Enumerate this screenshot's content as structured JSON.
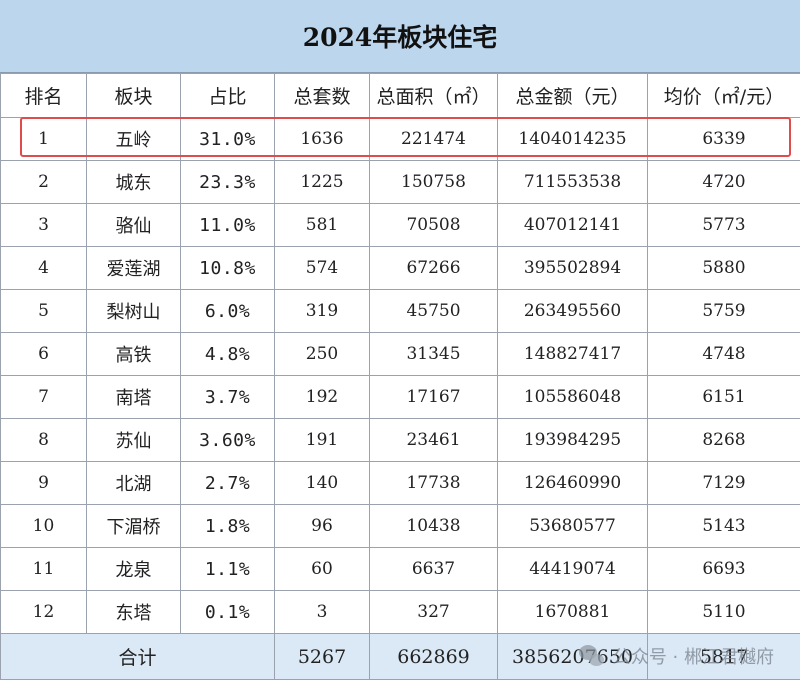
{
  "title": "2024年板块住宅",
  "headers": [
    "排名",
    "板块",
    "占比",
    "总套数",
    "总面积（㎡）",
    "总金额（元）",
    "均价（㎡/元）"
  ],
  "rows": [
    [
      "1",
      "五岭",
      "31.0%",
      "1636",
      "221474",
      "1404014235",
      "6339"
    ],
    [
      "2",
      "城东",
      "23.3%",
      "1225",
      "150758",
      "711553538",
      "4720"
    ],
    [
      "3",
      "骆仙",
      "11.0%",
      "581",
      "70508",
      "407012141",
      "5773"
    ],
    [
      "4",
      "爱莲湖",
      "10.8%",
      "574",
      "67266",
      "395502894",
      "5880"
    ],
    [
      "5",
      "梨树山",
      "6.0%",
      "319",
      "45750",
      "263495560",
      "5759"
    ],
    [
      "6",
      "高铁",
      "4.8%",
      "250",
      "31345",
      "148827417",
      "4748"
    ],
    [
      "7",
      "南塔",
      "3.7%",
      "192",
      "17167",
      "105586048",
      "6151"
    ],
    [
      "8",
      "苏仙",
      "3.60%",
      "191",
      "23461",
      "193984295",
      "8268"
    ],
    [
      "9",
      "北湖",
      "2.7%",
      "140",
      "17738",
      "126460990",
      "7129"
    ],
    [
      "10",
      "下湄桥",
      "1.8%",
      "96",
      "10438",
      "53680577",
      "5143"
    ],
    [
      "11",
      "龙泉",
      "1.1%",
      "60",
      "6637",
      "44419074",
      "6693"
    ],
    [
      "12",
      "东塔",
      "0.1%",
      "3",
      "327",
      "1670881",
      "5110"
    ]
  ],
  "total": {
    "label": "合计",
    "units": "5267",
    "area": "662869",
    "amount": "3856207650",
    "avg_price": "5817"
  },
  "highlight_row": 1,
  "colors": {
    "title_bg": "#bcd6ee",
    "total_bg": "#dbe8f5",
    "highlight_border": "#e04b4b",
    "grid": "#9aa3ad"
  },
  "watermark": {
    "text": "公众号 · 郴江君樾府",
    "icon": "wechat-icon"
  }
}
